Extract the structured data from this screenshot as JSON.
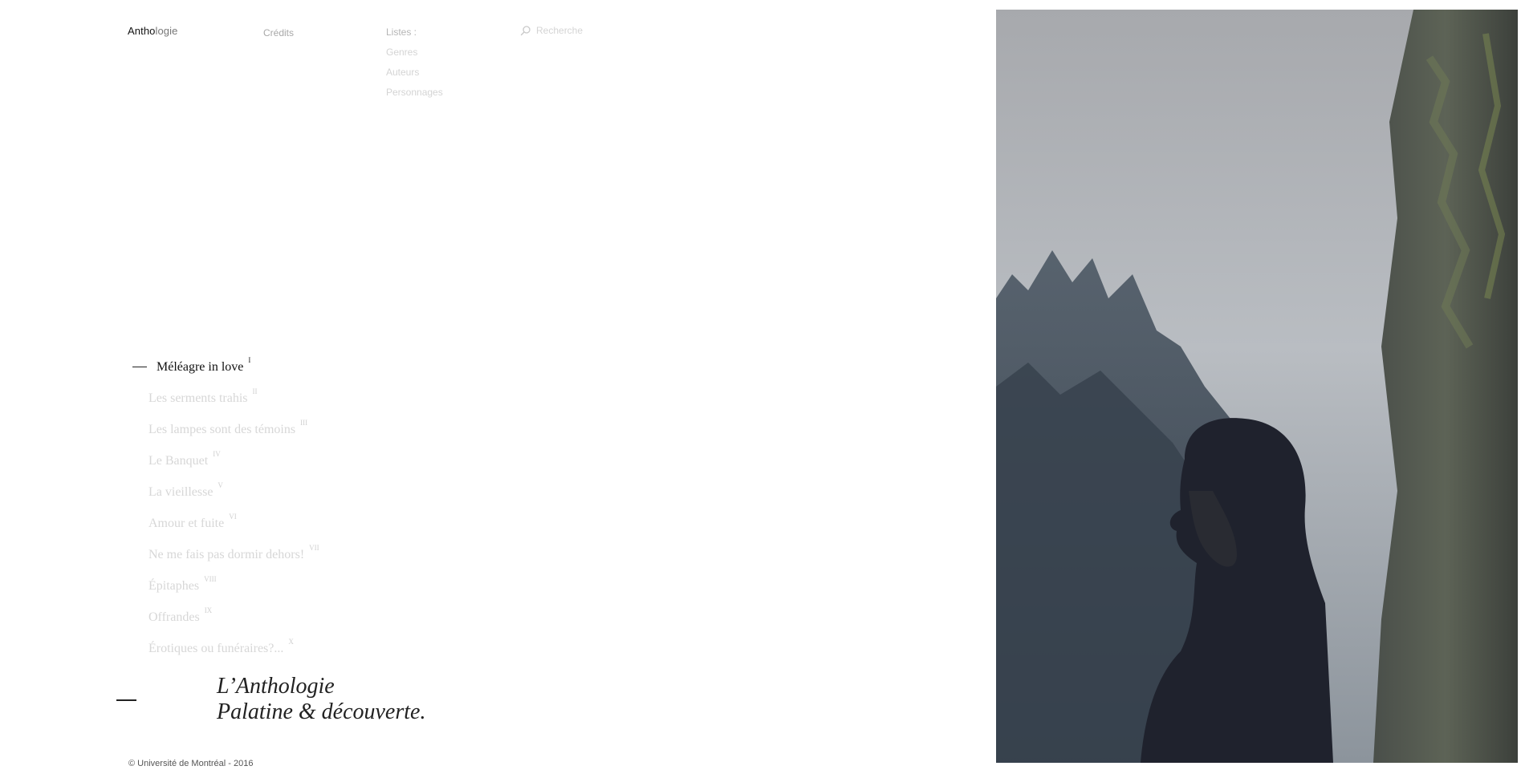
{
  "header": {
    "logo_bold": "Antho",
    "logo_light": "logie",
    "nav_credits": "Crédits",
    "lists_heading": "Listes :",
    "lists_items": [
      "Genres",
      "Auteurs",
      "Personnages"
    ],
    "search_placeholder": "Recherche",
    "search_icon": "search-icon"
  },
  "chapters": [
    {
      "title": "Méléagre in love",
      "numeral": "I",
      "active": true
    },
    {
      "title": "Les serments trahis",
      "numeral": "II",
      "active": false
    },
    {
      "title": "Les lampes sont des témoins",
      "numeral": "III",
      "active": false
    },
    {
      "title": "Le Banquet",
      "numeral": "IV",
      "active": false
    },
    {
      "title": "La vieillesse",
      "numeral": "V",
      "active": false
    },
    {
      "title": "Amour et fuite",
      "numeral": "VI",
      "active": false
    },
    {
      "title": "Ne me fais pas dormir dehors!",
      "numeral": "VII",
      "active": false
    },
    {
      "title": "Épitaphes",
      "numeral": "VIII",
      "active": false
    },
    {
      "title": "Offrandes",
      "numeral": "IX",
      "active": false
    },
    {
      "title": "Érotiques ou funéraires?...",
      "numeral": "X",
      "active": false
    }
  ],
  "tagline": {
    "line1": "L’Anthologie",
    "line2": "Palatine & découverte."
  },
  "footer": {
    "copyright": "© Université de Montréal - 2016"
  },
  "colors": {
    "active_text": "#111111",
    "inactive_text": "#d7d7d7",
    "nav_text": "#a8a8a8"
  }
}
